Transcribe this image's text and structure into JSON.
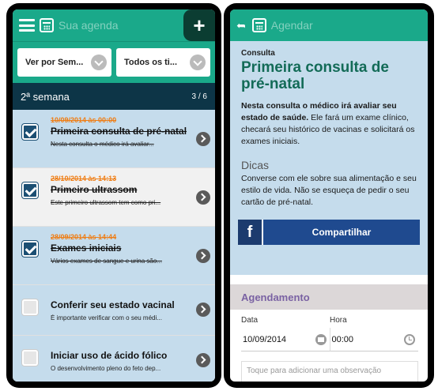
{
  "left": {
    "topbar": {
      "title": "Sua agenda",
      "add_label": "+"
    },
    "filters": [
      {
        "label": "Ver por Sem..."
      },
      {
        "label": "Todos os ti..."
      }
    ],
    "week": {
      "label": "2ª semana",
      "count": "3 / 6"
    },
    "items": [
      {
        "date": "10/09/2014 às 00:00",
        "title": "Primeira consulta de pré-natal",
        "desc": "Nesta consulta o médico irá avaliar...",
        "checked": true
      },
      {
        "date": "28/10/2014 às 14:13",
        "title": "Primeiro ultrassom",
        "desc": "Este primeiro ultrassom tem como pri...",
        "checked": true
      },
      {
        "date": "28/09/2014 às 14:44",
        "title": "Exames iniciais",
        "desc": "Vários exames de sangue e urina são...",
        "checked": true
      },
      {
        "date": "",
        "title": "Conferir seu estado vacinal",
        "desc": "É importante verificar com o seu médi...",
        "checked": false
      },
      {
        "date": "",
        "title": "Iniciar uso de ácido fólico",
        "desc": "O desenvolvimento pleno do feto dep...",
        "checked": false
      }
    ]
  },
  "right": {
    "topbar": {
      "title": "Agendar"
    },
    "category": "Consulta",
    "title": "Primeira consulta de pré-natal",
    "body_bold": "Nesta consulta o médico irá avaliar seu estado de saúde.",
    "body_rest": " Ele fará um exame clínico, checará seu histórico de vacinas e solicitará os exames iniciais.",
    "tips_heading": "Dicas",
    "tips_text": "Converse com ele sobre sua alimentação e seu estilo de vida. Não se esqueça de pedir o seu cartão de pré-natal.",
    "share": {
      "fb_label": "f",
      "label": "Compartilhar"
    },
    "schedule": {
      "heading": "Agendamento",
      "date_label": "Data",
      "time_label": "Hora",
      "date_value": "10/09/2014",
      "time_value": "00:00",
      "note_placeholder": "Toque para adicionar uma observação"
    }
  },
  "colors": {
    "green": "#1aa98a",
    "navy": "#0d3547",
    "blue_row": "#c5dcec",
    "orange_date": "#ef7d14",
    "purple": "#7a62a3"
  }
}
